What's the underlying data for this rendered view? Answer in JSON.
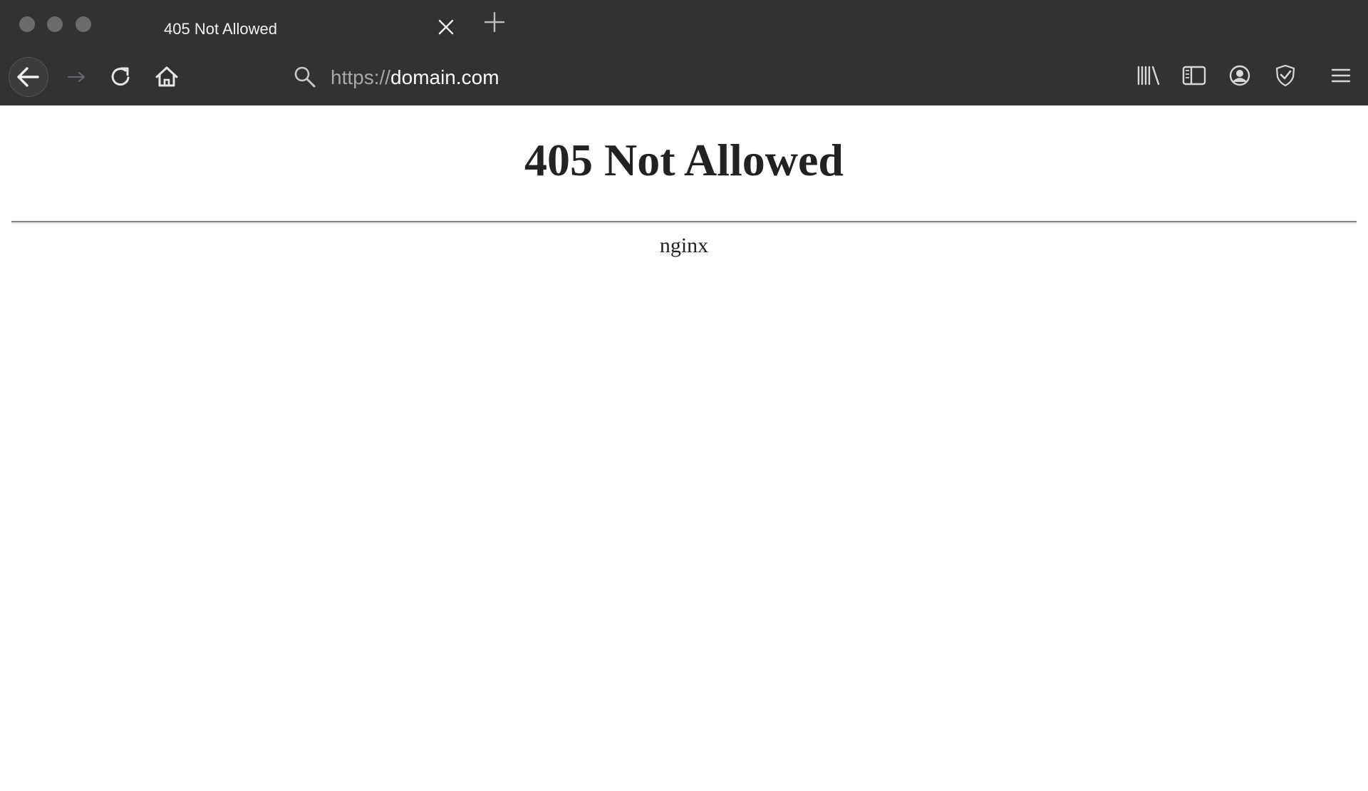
{
  "browser": {
    "tab": {
      "title": "405 Not Allowed"
    },
    "address_bar": {
      "scheme": "https://",
      "host": "domain.com"
    }
  },
  "page": {
    "heading": "405 Not Allowed",
    "server": "nginx"
  },
  "icons": {
    "tab_close": "close-icon",
    "new_tab": "plus-icon",
    "back": "arrow-left-icon",
    "forward": "arrow-right-icon",
    "reload": "reload-icon",
    "home": "home-icon",
    "search": "search-icon",
    "library": "library-icon",
    "sidebar": "sidebar-icon",
    "account": "account-icon",
    "shield": "shield-check-icon",
    "menu": "hamburger-menu-icon"
  },
  "colors": {
    "chrome_background": "#323234",
    "page_background": "#ffffff",
    "heading_text": "#222222"
  }
}
